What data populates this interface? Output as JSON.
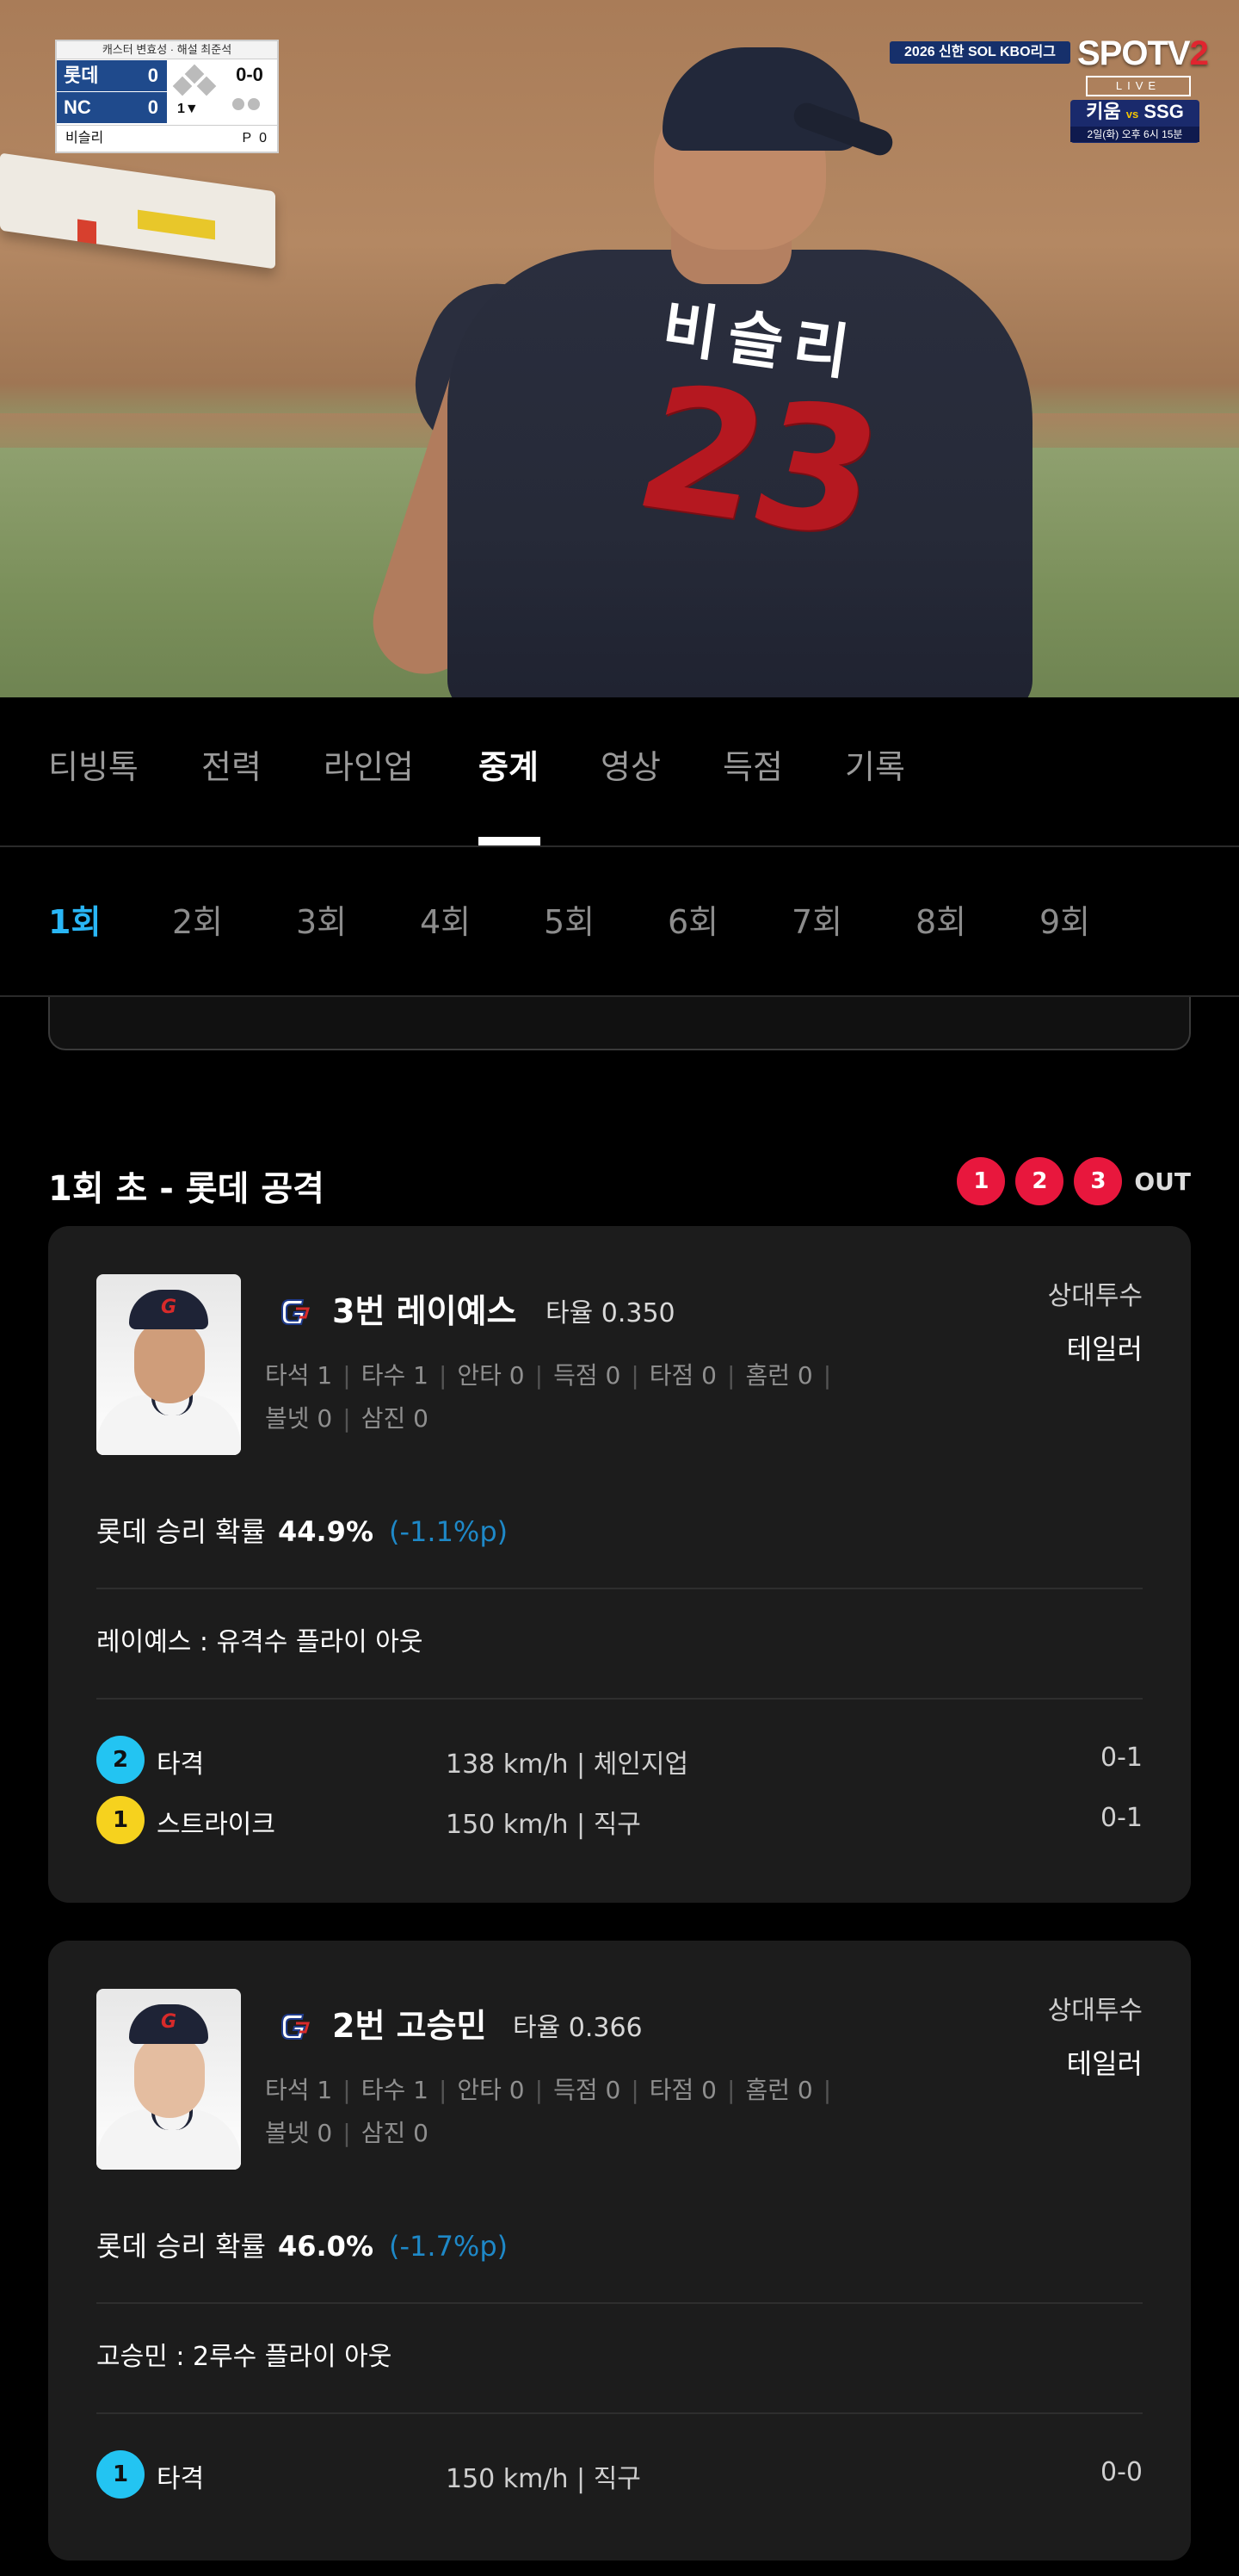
{
  "video": {
    "scorebug": {
      "caster": "캐스터 변효성 · 해설 최준석",
      "away_team": "롯데",
      "away_score": "0",
      "home_team": "NC",
      "home_score": "0",
      "inning": "1▼",
      "count": "0-0",
      "pitcher_name": "비슬리",
      "pitch_count_label": "P",
      "pitch_count": "0"
    },
    "broadcast": {
      "league_badge": "2026 신한 SOL KBO리그",
      "channel": "SPOTV",
      "channel_num": "2",
      "live": "LIVE",
      "next_home": "키움",
      "next_vs": "vs",
      "next_away": "SSG",
      "next_time": "2일(화) 오후 6시 15분"
    },
    "jersey": {
      "name": "비슬리",
      "number": "23"
    }
  },
  "main_tabs": [
    {
      "label": "티빙톡"
    },
    {
      "label": "전력"
    },
    {
      "label": "라인업"
    },
    {
      "label": "중계"
    },
    {
      "label": "영상"
    },
    {
      "label": "득점"
    },
    {
      "label": "기록"
    }
  ],
  "inning_tabs": [
    {
      "label": "1회"
    },
    {
      "label": "2회"
    },
    {
      "label": "3회"
    },
    {
      "label": "4회"
    },
    {
      "label": "5회"
    },
    {
      "label": "6회"
    },
    {
      "label": "7회"
    },
    {
      "label": "8회"
    },
    {
      "label": "9회"
    }
  ],
  "section": {
    "title": "1회 초 - 롯데 공격",
    "outs": [
      "1",
      "2",
      "3"
    ],
    "out_label": "OUT"
  },
  "cards": [
    {
      "batter": "3번 레이예스",
      "avg_label": "타율 0.350",
      "stats_line1": [
        "타석 1",
        "타수 1",
        "안타 0",
        "득점 0",
        "타점 0",
        "홈런 0"
      ],
      "stats_line2": [
        "볼넷 0",
        "삼진 0"
      ],
      "opp_label": "상대투수",
      "opp_name": "테일러",
      "win_prob_label": "롯데 승리 확률",
      "win_prob": "44.9%",
      "win_prob_delta": "(-1.1%p)",
      "result": "레이예스 : 유격수 플라이 아웃",
      "pitches": [
        {
          "num": "2",
          "type": "타격",
          "detail": "138 km/h | 체인지업",
          "count": "0-1"
        },
        {
          "num": "1",
          "type": "스트라이크",
          "detail": "150 km/h | 직구",
          "count": "0-1"
        }
      ]
    },
    {
      "batter": "2번 고승민",
      "avg_label": "타율 0.366",
      "stats_line1": [
        "타석 1",
        "타수 1",
        "안타 0",
        "득점 0",
        "타점 0",
        "홈런 0"
      ],
      "stats_line2": [
        "볼넷 0",
        "삼진 0"
      ],
      "opp_label": "상대투수",
      "opp_name": "테일러",
      "win_prob_label": "롯데 승리 확률",
      "win_prob": "46.0%",
      "win_prob_delta": "(-1.7%p)",
      "result": "고승민 : 2루수 플라이 아웃",
      "pitches": [
        {
          "num": "1",
          "type": "타격",
          "detail": "150 km/h | 직구",
          "count": "0-0"
        }
      ]
    }
  ],
  "colors": {
    "accent": "#29b6f6",
    "out_red": "#e8173d",
    "ball_cyan": "#23c4f2",
    "strike_yellow": "#f6d21e",
    "delta_blue": "#1e88c7"
  }
}
